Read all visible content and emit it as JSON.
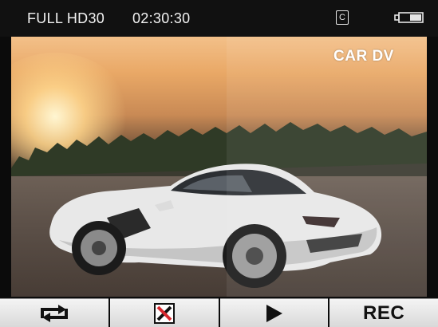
{
  "status_bar": {
    "resolution": "FULL HD30",
    "elapsed_time": "02:30:30",
    "cyclic_badge": "C",
    "battery_icon": "battery-icon"
  },
  "preview": {
    "overlay_text": "CAR DV"
  },
  "toolbar": {
    "buttons": [
      {
        "icon": "loop-record-icon"
      },
      {
        "icon": "mute-icon"
      },
      {
        "icon": "play-icon"
      },
      {
        "label": "REC"
      }
    ]
  },
  "colors": {
    "status_bar_bg": "#111111",
    "status_text": "#f2f2f2",
    "toolbar_bg": "#e8e8e8",
    "icon_color": "#111111",
    "mute_red": "#d8282e"
  }
}
